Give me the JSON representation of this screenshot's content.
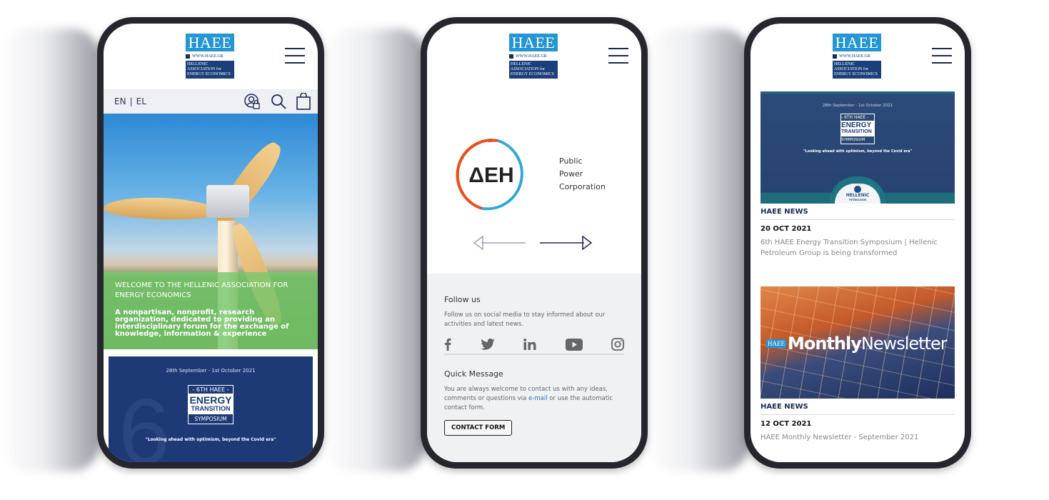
{
  "brand": {
    "logo_top": "HAEE",
    "logo_url": "WWW.HAEE.GR",
    "logo_name_lines": [
      "HELLENIC",
      "ASSOCIATION for",
      "ENERGY ECONOMICS"
    ],
    "colors": {
      "logo_blue": "#2596d3",
      "navy": "#1b2a55",
      "logo_dark": "#1b3f7a",
      "welcome_green": "#78c86e"
    }
  },
  "phone1": {
    "lang": {
      "en": "EN",
      "sep": "|",
      "el": "EL"
    },
    "icons": [
      "user-lock-icon",
      "search-icon",
      "shopping-bag-icon"
    ],
    "welcome": {
      "title": "WELCOME TO THE HELLENIC ASSOCIATION FOR ENERGY ECONOMICS",
      "description": "A nonpartisan, nonprofit, research organization, dedicated to providing an interdisciplinary forum for the exchange of knowledge, information & experience"
    },
    "symposium": {
      "date": "28th September - 1st October 2021",
      "badge_top": "- 6TH HAEE -",
      "badge_main_1": "ENERGY",
      "badge_main_2": "TRANSITION",
      "badge_bottom": "SYMPOSIUM",
      "quote": "\"Looking ahead with optimism, beyond the Covid era\""
    }
  },
  "phone2": {
    "partner": {
      "logo_text": "ΔEH",
      "name_lines": [
        "Public",
        "Power",
        "Corporation"
      ],
      "ring_colors": [
        "#e8501e",
        "#2ea8dc"
      ]
    },
    "follow": {
      "heading": "Follow us",
      "text": "Follow us on social media to stay informed about our activities and latest news.",
      "socials": [
        "facebook-icon",
        "twitter-icon",
        "linkedin-icon",
        "youtube-icon",
        "instagram-icon"
      ]
    },
    "quick_message": {
      "heading": "Quick Message",
      "text_before": "You are always welcome to contact us with any ideas, comments or questions via ",
      "link": "e-mail",
      "text_after": " or use the automatic contact form.",
      "button": "CONTACT FORM"
    }
  },
  "phone3": {
    "news": [
      {
        "image": {
          "date": "28th September - 1st October 2021",
          "badge_top": "- 6TH HAEE -",
          "badge_main_1": "ENERGY",
          "badge_main_2": "TRANSITION",
          "badge_bottom": "SYMPOSIUM",
          "quote": "\"Looking ahead with optimism, beyond the Covid era\"",
          "sponsor_name": "HELLENIC",
          "sponsor_sub": "PETROLEUM"
        },
        "category": "HAEE NEWS",
        "date": "20 OCT 2021",
        "title": "6th HAEE Energy Transition Symposium | Hellenic Petroleum Group is being transformed"
      },
      {
        "image": {
          "haee": "HAEE",
          "monthly": "Monthly",
          "newsletter": "Newsletter"
        },
        "category": "HAEE NEWS",
        "date": "12 OCT 2021",
        "title": "HAEE Monthly Newsletter - September 2021"
      }
    ]
  }
}
